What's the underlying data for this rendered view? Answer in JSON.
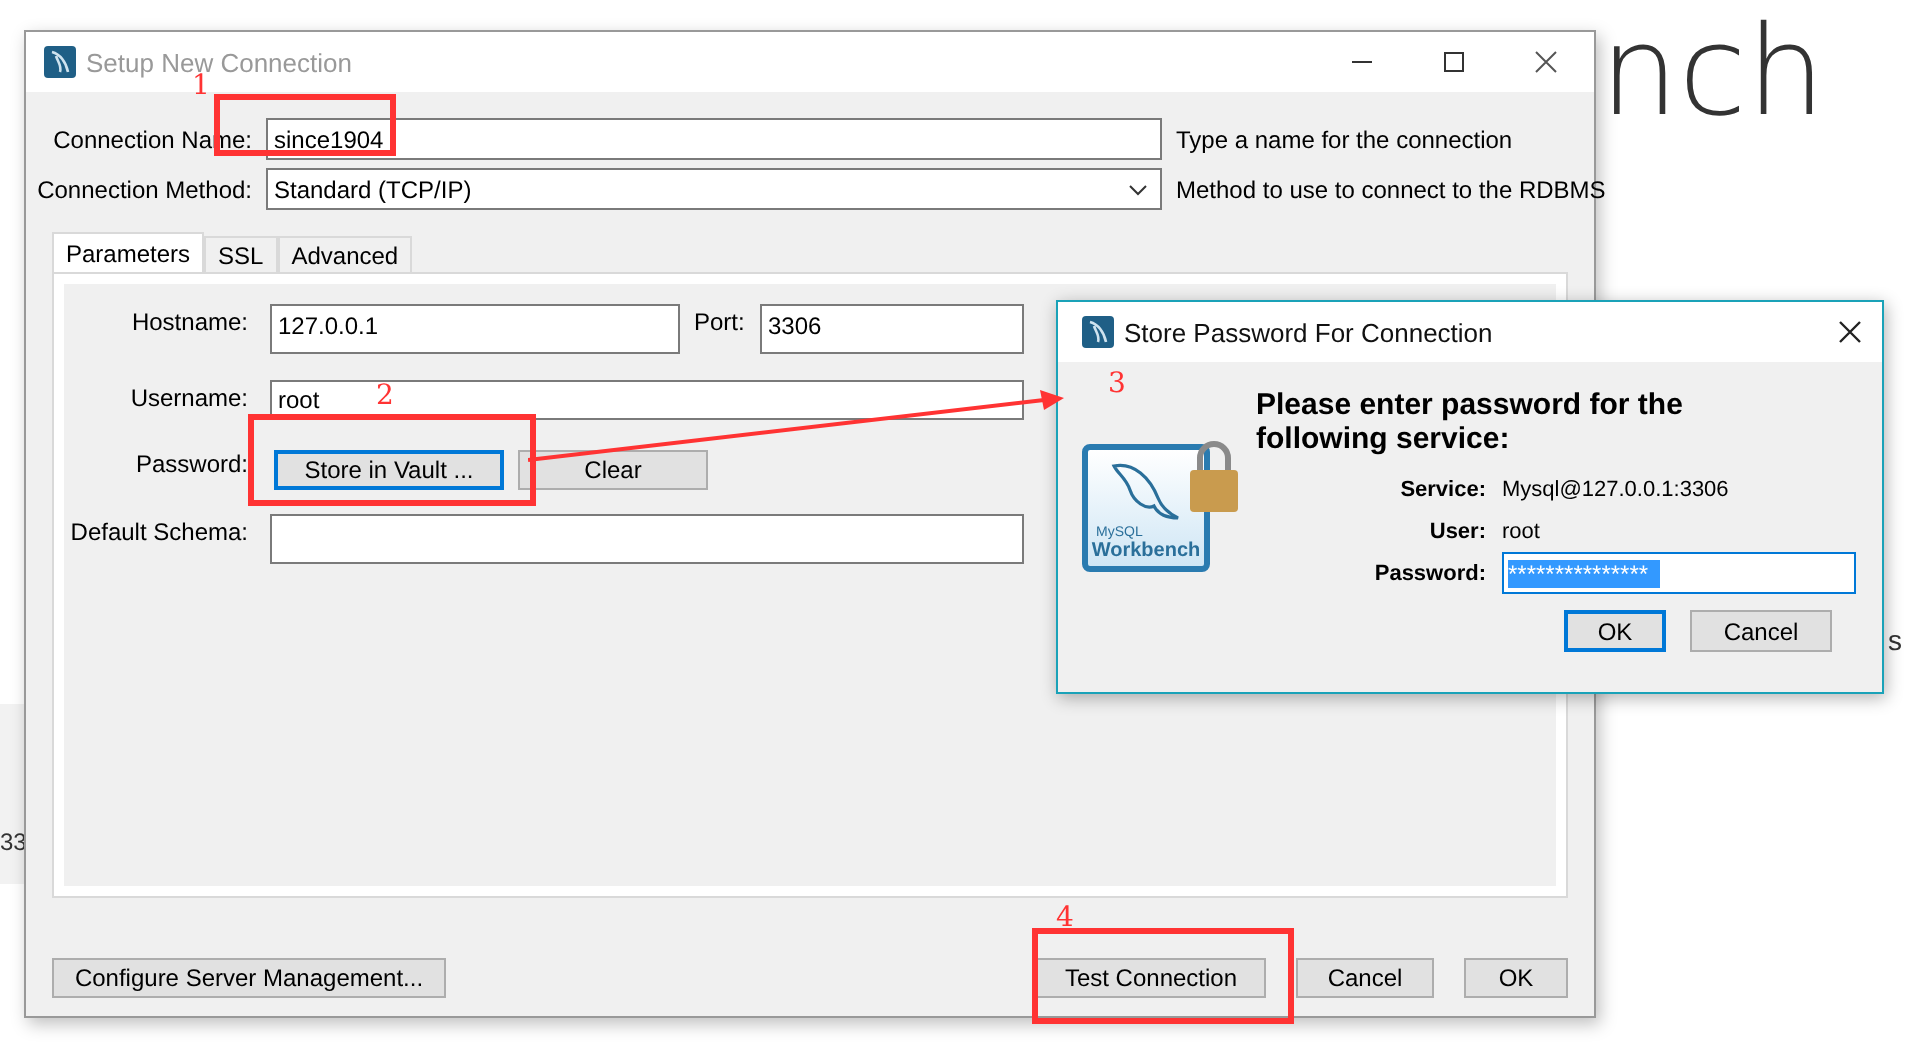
{
  "background": {
    "heading_fragment": "nch",
    "side_fragments": [
      "33",
      "s"
    ]
  },
  "main_window": {
    "title": "Setup New Connection",
    "fields": [
      {
        "kind": "text",
        "label": "Connection Name:",
        "value": "since1904",
        "hint": "Type a name for the connection"
      },
      {
        "kind": "select",
        "label": "Connection Method:",
        "value": "Standard (TCP/IP)",
        "hint": "Method to use to connect to the RDBMS"
      }
    ],
    "tabs": [
      {
        "label": "Parameters",
        "selected": true
      },
      {
        "label": "SSL",
        "selected": false
      },
      {
        "label": "Advanced",
        "selected": false
      }
    ],
    "parameters": {
      "hostname": {
        "label": "Hostname:",
        "value": "127.0.0.1"
      },
      "port": {
        "label": "Port:",
        "value": "3306"
      },
      "username": {
        "label": "Username:",
        "value": "root"
      },
      "password": {
        "label": "Password:",
        "buttons": [
          {
            "label": "Store in Vault ...",
            "focused": true
          },
          {
            "label": "Clear",
            "focused": false
          }
        ]
      },
      "default_schema": {
        "label": "Default Schema:"
      }
    },
    "footer_left_button": "Configure Server Management...",
    "footer_right_buttons": [
      "Test Connection",
      "Cancel",
      "OK"
    ]
  },
  "password_dialog": {
    "title": "Store Password For Connection",
    "logo": {
      "small_text": "MySQL",
      "text": "Workbench"
    },
    "heading": "Please enter password for the following service:",
    "rows": [
      {
        "label": "Service:",
        "value": "Mysql@127.0.0.1:3306"
      },
      {
        "label": "User:",
        "value": "root"
      }
    ],
    "password": {
      "label": "Password:",
      "value": "***************",
      "selected": true
    },
    "buttons": [
      {
        "label": "OK",
        "default": true
      },
      {
        "label": "Cancel",
        "default": false
      }
    ]
  },
  "annotations": [
    {
      "label": "1"
    },
    {
      "label": "2"
    },
    {
      "label": "3"
    },
    {
      "label": "4"
    }
  ]
}
